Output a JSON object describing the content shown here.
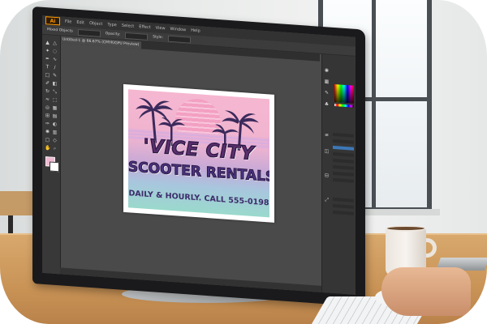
{
  "app": {
    "logo": "Ai",
    "menu": [
      "File",
      "Edit",
      "Object",
      "Type",
      "Select",
      "Effect",
      "View",
      "Window",
      "Help"
    ],
    "control_bar": {
      "mode_label": "Mixed Objects",
      "opacity_label": "Opacity:",
      "style_label": "Style:"
    },
    "tab_title": "Untitled-1 @ 66.67% (CMYK/GPU Preview)"
  },
  "artwork": {
    "line1": "'VICE CITY",
    "line2": "SCOOTER RENTALS",
    "line3": "DAILY & HOURLY. CALL 555-0198"
  },
  "colors": {
    "pink": "#f5b6d0",
    "purple": "#5a2f6e",
    "teal": "#9ad9cc",
    "ui_dark": "#4a4a4a",
    "accent": "#ff9a00"
  }
}
